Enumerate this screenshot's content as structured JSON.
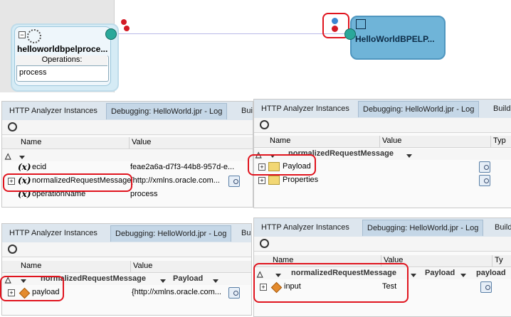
{
  "composite": {
    "left_component": {
      "title": "helloworldbpelproce...",
      "operations_header": "Operations:",
      "operation": "process"
    },
    "right_component": {
      "title": "HelloWorldBPELP..."
    }
  },
  "tabs": {
    "http_analyzer": "HTTP Analyzer Instances",
    "debugging": "Debugging: HelloWorld.jpr - Log",
    "build_1": "Buil",
    "build_2": "Build",
    "build_4": "Build -"
  },
  "columns": {
    "name": "Name",
    "value": "Value",
    "type_1": "Ty",
    "type_2": "Typ"
  },
  "panel_top_left": {
    "rows": [
      {
        "name": "ecid",
        "value": "feae2a6a-d7f3-44b8-957d-e..."
      },
      {
        "name": "normalizedRequestMessage",
        "value": "{http://xmlns.oracle.com..."
      },
      {
        "name": "operationName",
        "value": "process"
      }
    ]
  },
  "panel_top_right": {
    "breadcrumb": [
      "normalizedRequestMessage"
    ],
    "rows": [
      {
        "name": "Payload"
      },
      {
        "name": "Properties"
      }
    ]
  },
  "panel_bottom_left": {
    "breadcrumb": [
      "normalizedRequestMessage",
      "Payload"
    ],
    "rows": [
      {
        "name": "payload",
        "value": "{http://xmlns.oracle.com..."
      }
    ]
  },
  "panel_bottom_right": {
    "breadcrumb": [
      "normalizedRequestMessage",
      "Payload",
      "payload"
    ],
    "rows": [
      {
        "name": "input",
        "value": "Test"
      }
    ]
  },
  "icons": {
    "variable": "(x)",
    "expand": "+",
    "search": "search-icon",
    "inspect": "magnifier-icon"
  },
  "colors": {
    "highlight": "#e0141e",
    "bpel_component": "#6fb4d8",
    "tab_active": "#c5d7e7"
  }
}
